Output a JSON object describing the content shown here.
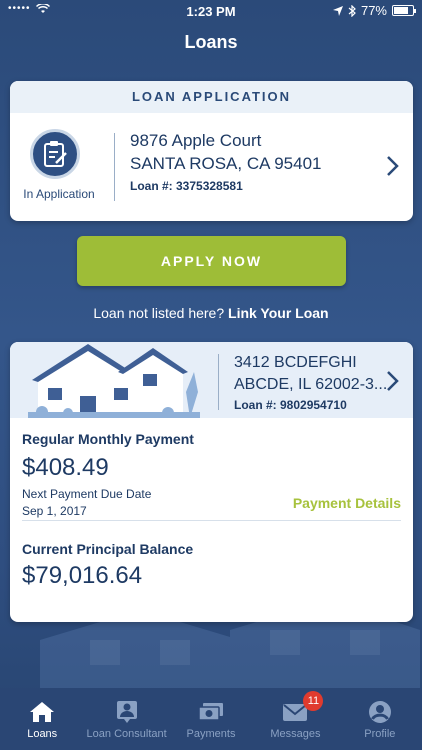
{
  "status_bar": {
    "dots": "•••••",
    "time": "1:23 PM",
    "battery": "77%",
    "battery_level": 0.77
  },
  "nav": {
    "title": "Loans"
  },
  "loan_application": {
    "header": "LOAN APPLICATION",
    "status": "In Application",
    "address_line1": "9876 Apple Court",
    "address_line2": "SANTA ROSA, CA 95401",
    "loan_number": "Loan #: 3375328581"
  },
  "apply_button": {
    "label": "APPLY NOW"
  },
  "link_prompt": {
    "text": "Loan not listed here?",
    "link": "Link Your Loan"
  },
  "loan": {
    "address_line1": "3412 BCDEFGHI",
    "address_line2": "ABCDE, IL 62002-3...",
    "loan_number": "Loan #: 9802954710",
    "payment_label": "Regular Monthly Payment",
    "payment_amount": "$408.49",
    "due_label": "Next Payment Due Date",
    "due_date": "Sep 1, 2017",
    "details_link": "Payment Details",
    "balance_label": "Current Principal Balance",
    "balance_amount": "$79,016.64"
  },
  "tabs": [
    {
      "label": "Loans",
      "icon": "home-icon",
      "active": true
    },
    {
      "label": "Loan Consultant",
      "icon": "consultant-icon",
      "active": false
    },
    {
      "label": "Payments",
      "icon": "payments-icon",
      "active": false
    },
    {
      "label": "Messages",
      "icon": "messages-icon",
      "active": false,
      "badge": "11"
    },
    {
      "label": "Profile",
      "icon": "profile-icon",
      "active": false
    }
  ],
  "colors": {
    "primary": "#2e4f83",
    "accent_green": "#9ebd37",
    "badge_red": "#e03b2e"
  }
}
